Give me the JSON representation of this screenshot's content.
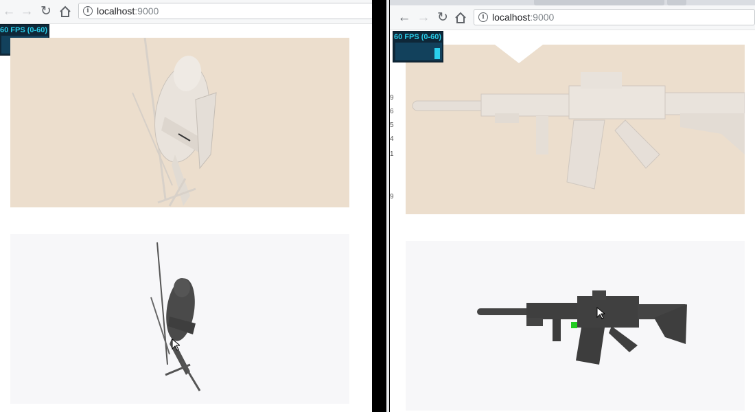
{
  "left_window": {
    "url_host": "localhost",
    "url_port": ":9000",
    "stats": {
      "fps_label": "60 FPS (0-60)",
      "fps_value": 60
    }
  },
  "right_window": {
    "url_host": "localhost",
    "url_port": ":9000",
    "stats": {
      "fps_label": "60 FPS (0-60)",
      "fps_value": 60
    },
    "cropped_glyphs": [
      "9",
      "6",
      "5",
      "4",
      "1",
      "9"
    ]
  },
  "icons": {
    "back": "arrow-left-icon",
    "forward": "arrow-right-icon",
    "reload": "reload-icon",
    "home": "home-icon",
    "info": "info-icon",
    "cursor": "mouse-cursor-icon"
  },
  "colors": {
    "beige_panel": "#ecdecd",
    "plain_panel": "#f7f7f9",
    "stats_bg": "#0e2738",
    "stats_text": "#29cde9",
    "model_shaded": "#e8e2db",
    "model_dark": "#444444",
    "marker_green": "#22cc22"
  }
}
